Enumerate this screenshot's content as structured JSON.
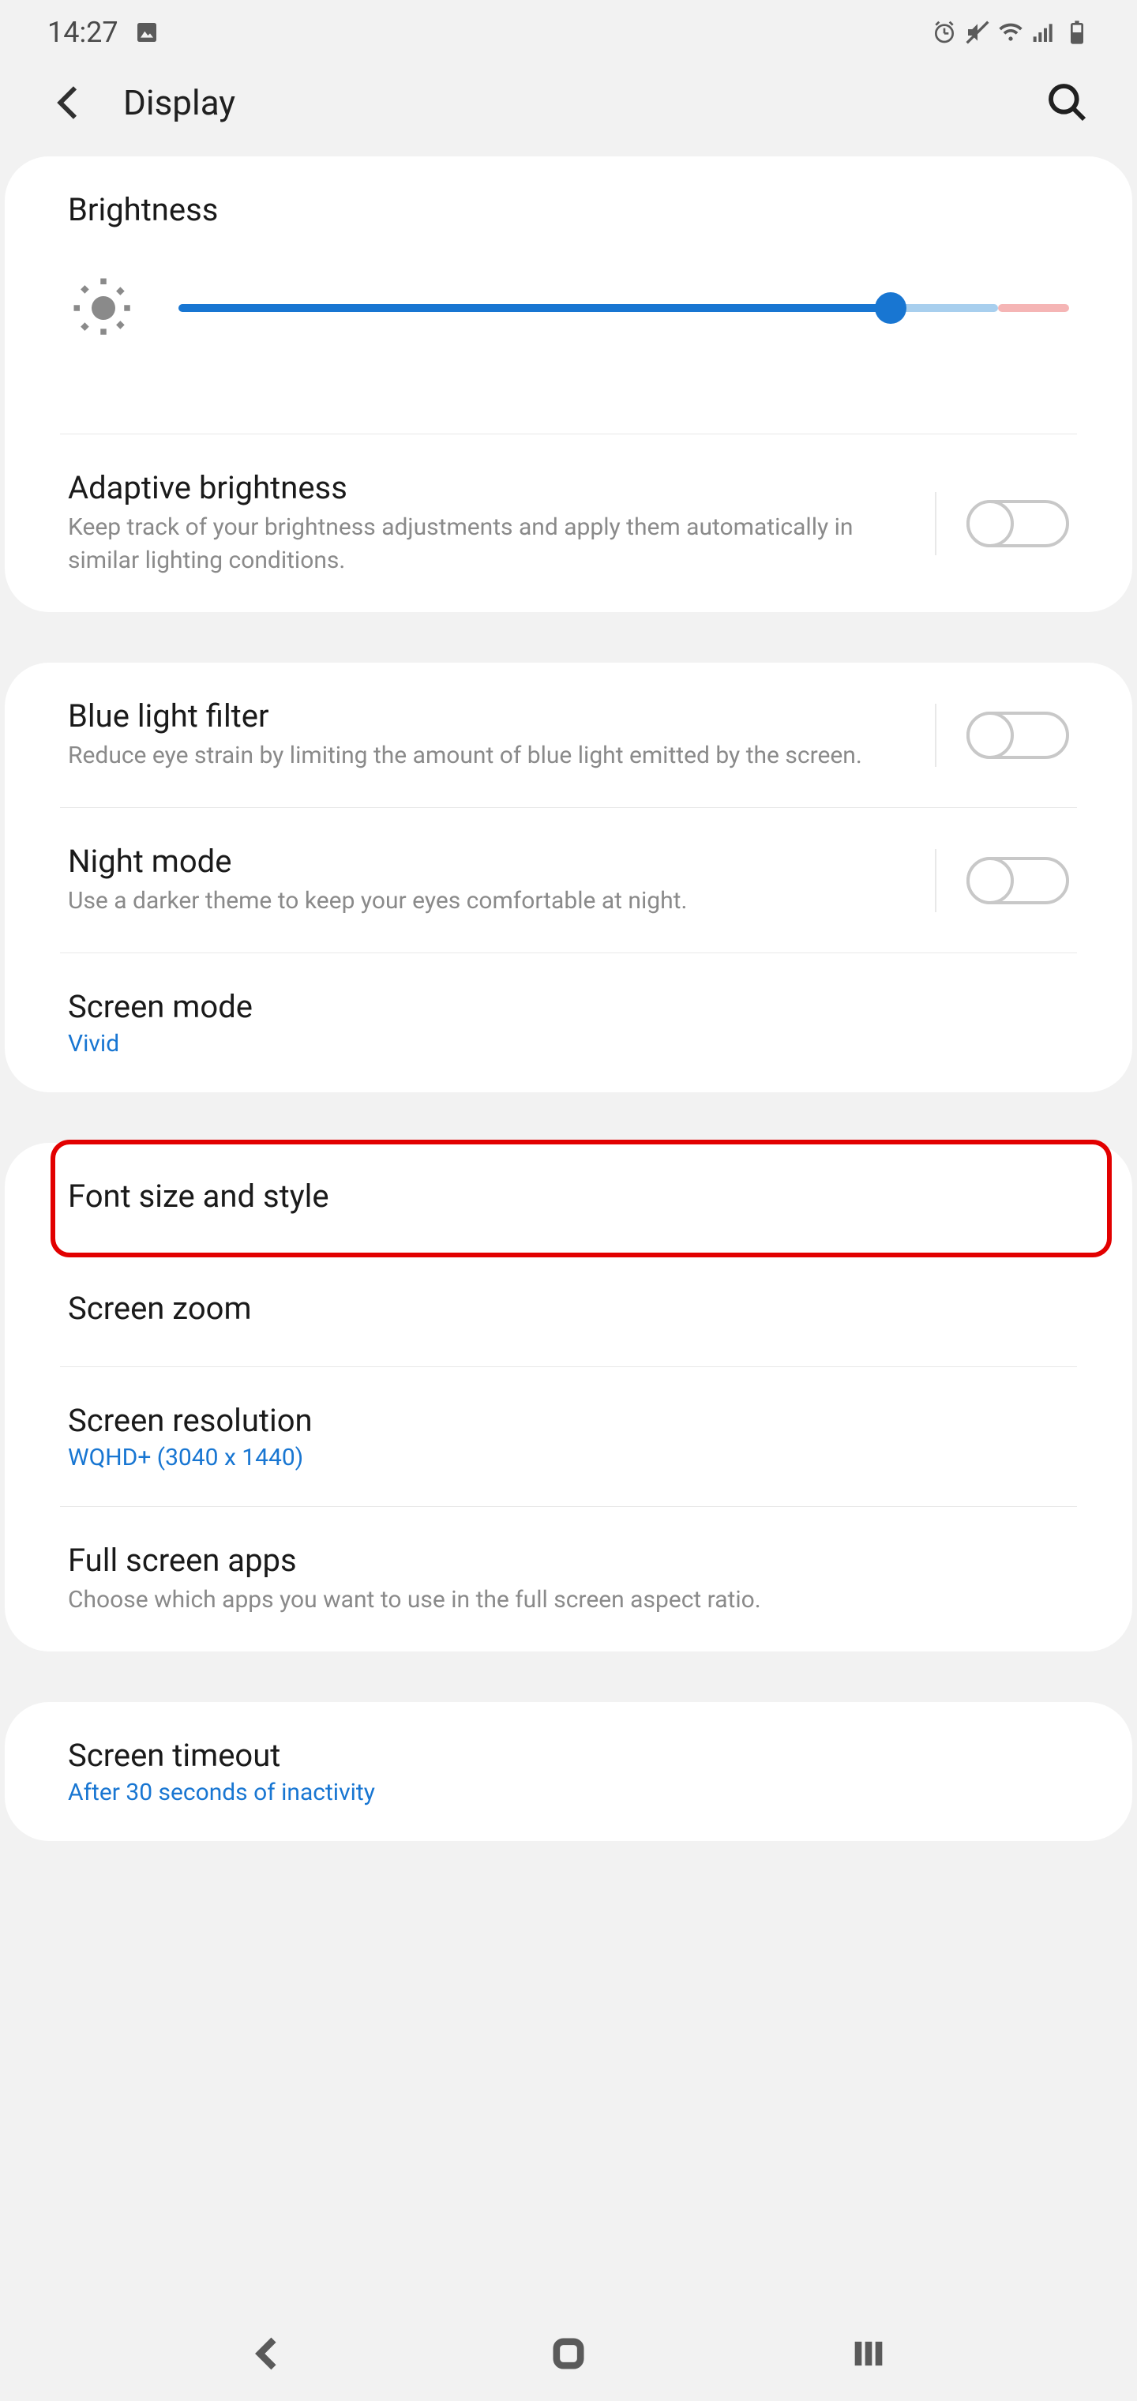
{
  "status": {
    "time": "14:27"
  },
  "header": {
    "title": "Display"
  },
  "brightness": {
    "title": "Brightness",
    "value": 80
  },
  "adaptive": {
    "title": "Adaptive brightness",
    "sub": "Keep track of your brightness adjustments and apply them automatically in similar lighting conditions.",
    "enabled": false
  },
  "bluelight": {
    "title": "Blue light filter",
    "sub": "Reduce eye strain by limiting the amount of blue light emitted by the screen.",
    "enabled": false
  },
  "nightmode": {
    "title": "Night mode",
    "sub": "Use a darker theme to keep your eyes comfortable at night.",
    "enabled": false
  },
  "screenmode": {
    "title": "Screen mode",
    "value": "Vivid"
  },
  "fontsize": {
    "title": "Font size and style"
  },
  "screenzoom": {
    "title": "Screen zoom"
  },
  "screenres": {
    "title": "Screen resolution",
    "value": "WQHD+ (3040 x 1440)"
  },
  "fullscreen": {
    "title": "Full screen apps",
    "sub": "Choose which apps you want to use in the full screen aspect ratio."
  },
  "screentimeout": {
    "title": "Screen timeout",
    "value": "After 30 seconds of inactivity"
  }
}
